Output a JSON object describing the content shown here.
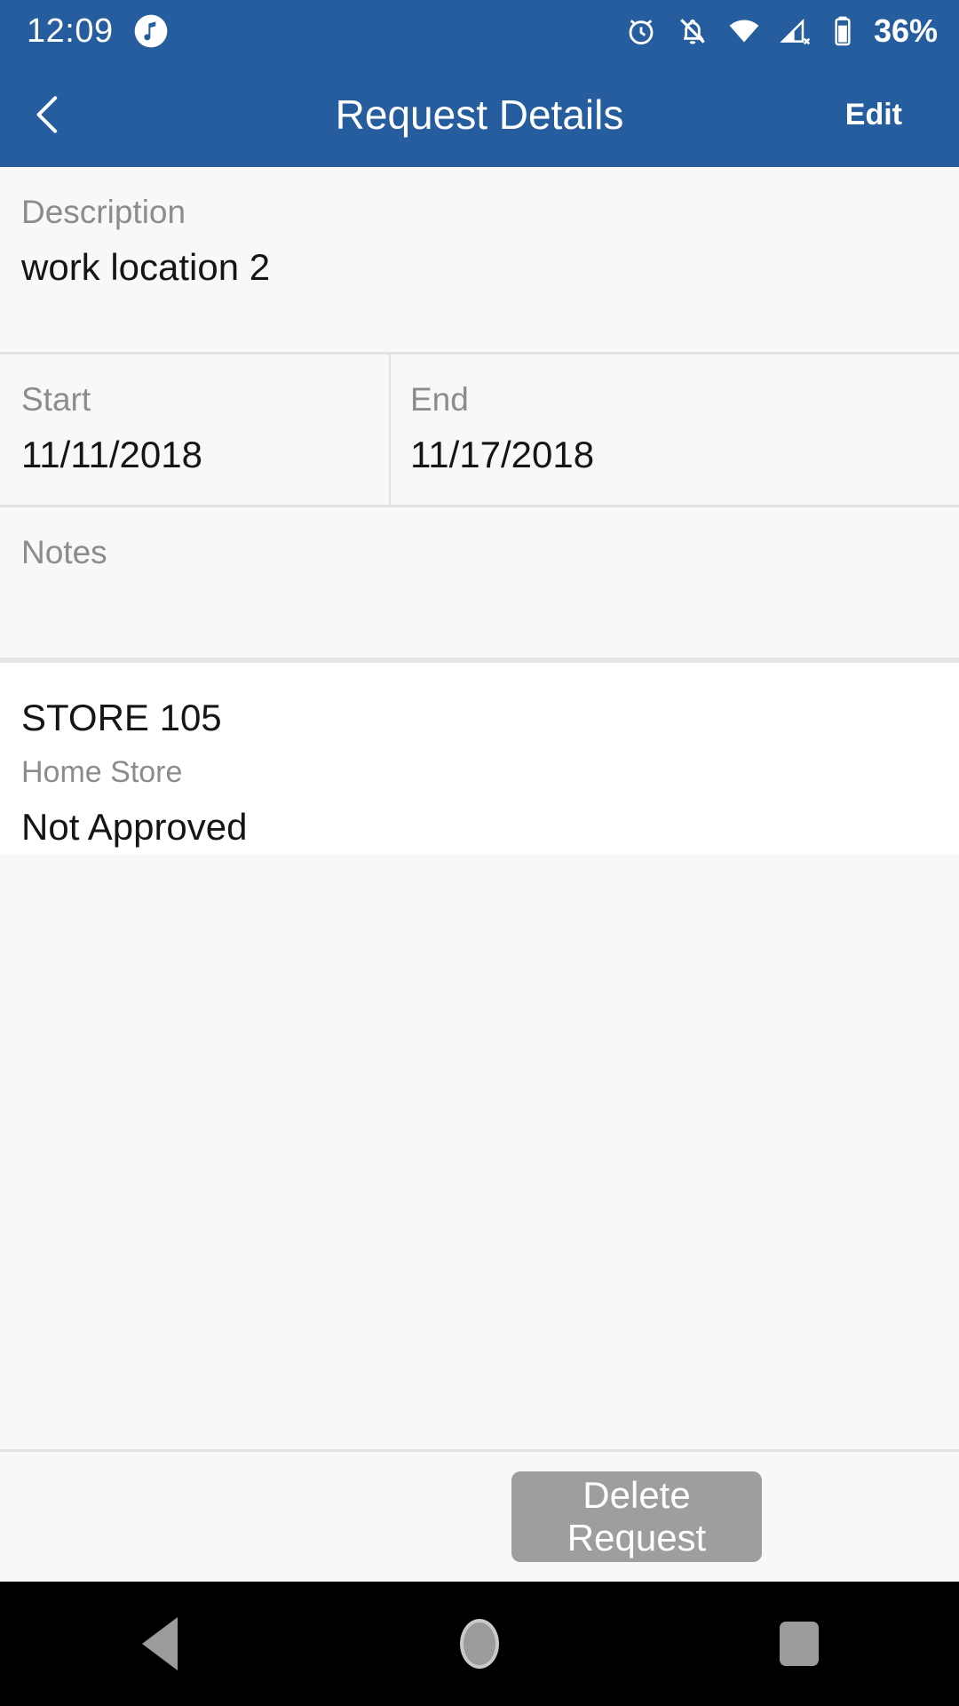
{
  "status_bar": {
    "time": "12:09",
    "battery_text": "36%",
    "icons": {
      "music": "music-note-icon",
      "alarm": "alarm-clock-icon",
      "silent": "bell-off-icon",
      "wifi": "wifi-icon",
      "cellular": "cellular-no-service-icon",
      "battery": "battery-icon"
    },
    "background_color": "#255d9e"
  },
  "header": {
    "title": "Request Details",
    "back_icon": "chevron-left-icon",
    "edit_label": "Edit",
    "background_color": "#255d9e",
    "text_color": "#ffffff"
  },
  "fields": {
    "description": {
      "label": "Description",
      "value": "work location 2"
    },
    "start": {
      "label": "Start",
      "value": "11/11/2018"
    },
    "end": {
      "label": "End",
      "value": "11/17/2018"
    },
    "notes": {
      "label": "Notes",
      "value": ""
    }
  },
  "store_card": {
    "name": "STORE 105",
    "type": "Home Store",
    "status": "Not Approved",
    "status_color": "#151515"
  },
  "footer": {
    "delete_label": "Delete Request",
    "delete_color": "#9e9e9e"
  },
  "nav_bar": {
    "back_icon": "triangle-back-icon",
    "home_icon": "circle-home-icon",
    "recents_icon": "square-recents-icon",
    "background_color": "#000000"
  }
}
